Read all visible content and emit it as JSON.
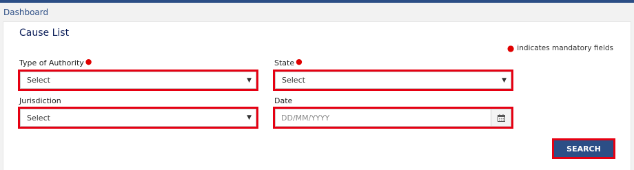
{
  "breadcrumb": {
    "label": "Dashboard"
  },
  "page": {
    "title": "Cause List",
    "mandatory_note": "indicates mandatory fields"
  },
  "form": {
    "authority": {
      "label": "Type of Authority",
      "value": "Select",
      "required": true
    },
    "state": {
      "label": "State",
      "value": "Select",
      "required": true
    },
    "jurisdiction": {
      "label": "Jurisdiction",
      "value": "Select",
      "required": false
    },
    "date": {
      "label": "Date",
      "placeholder": "DD/MM/YYYY",
      "required": false
    }
  },
  "actions": {
    "search_label": "SEARCH"
  },
  "colors": {
    "brand": "#2c4e86",
    "highlight": "#e60012",
    "required": "#e00000",
    "title": "#0b1e59"
  },
  "icons": {
    "caret": "caret-down-icon",
    "calendar": "calendar-icon",
    "required": "required-dot-icon"
  }
}
